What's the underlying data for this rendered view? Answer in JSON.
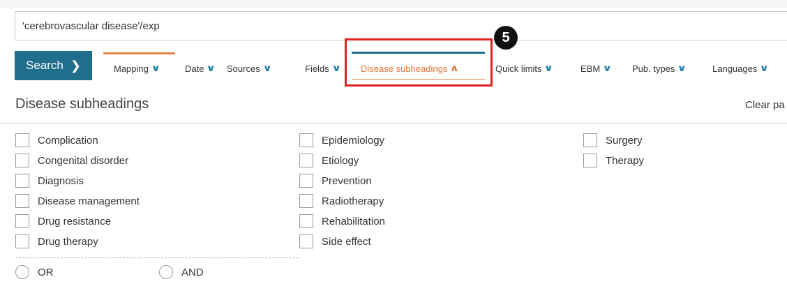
{
  "query": {
    "value": "'cerebrovascular disease'/exp"
  },
  "toolbar": {
    "search_label": "Search",
    "search_chevron": "❯",
    "tabs": [
      {
        "label": "Mapping",
        "caret": "∨"
      },
      {
        "label": "Date",
        "caret": "∨"
      },
      {
        "label": "Sources",
        "caret": "∨"
      },
      {
        "label": "Fields",
        "caret": "∨"
      },
      {
        "label": "Disease subheadings",
        "caret": "∧"
      },
      {
        "label": "Quick limits",
        "caret": "∨"
      },
      {
        "label": "EBM",
        "caret": "∨"
      },
      {
        "label": "Pub. types",
        "caret": "∨"
      },
      {
        "label": "Languages",
        "caret": "∨"
      }
    ],
    "active_tab": "Disease subheadings"
  },
  "annotation": {
    "step_number": "5"
  },
  "panel": {
    "title": "Disease subheadings",
    "clear_label": "Clear pa",
    "columns": [
      [
        "Complication",
        "Congenital disorder",
        "Diagnosis",
        "Disease management",
        "Drug resistance",
        "Drug therapy"
      ],
      [
        "Epidemiology",
        "Etiology",
        "Prevention",
        "Radiotherapy",
        "Rehabilitation",
        "Side effect"
      ],
      [
        "Surgery",
        "Therapy"
      ]
    ],
    "operators": [
      "OR",
      "AND"
    ]
  },
  "colors": {
    "accent_blue": "#1f6e8c",
    "accent_orange": "#e8743a",
    "highlight_red": "#e02020"
  }
}
